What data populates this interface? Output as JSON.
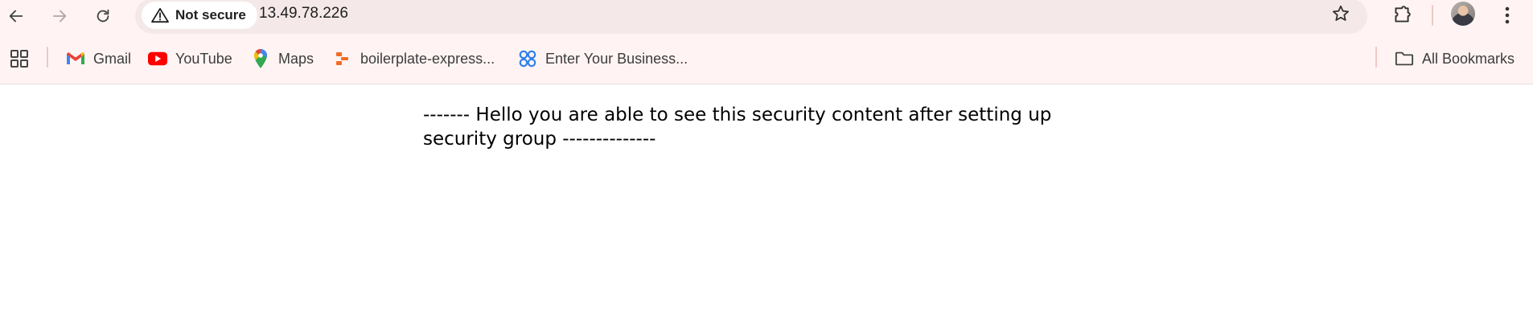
{
  "browser": {
    "security_label": "Not secure",
    "url": "13.49.78.226"
  },
  "bookmarks": [
    {
      "label": "Gmail",
      "icon": "gmail-icon"
    },
    {
      "label": "YouTube",
      "icon": "youtube-icon"
    },
    {
      "label": "Maps",
      "icon": "maps-icon"
    },
    {
      "label": "boilerplate-express...",
      "icon": "boilerplate-icon"
    },
    {
      "label": "Enter Your Business...",
      "icon": "business-icon"
    }
  ],
  "all_bookmarks_label": "All Bookmarks",
  "page": {
    "message": "------- Hello you are able to see this security content after setting up security group --------------"
  },
  "colors": {
    "chrome_bg": "#fff4f3",
    "omnibox_bg": "#f4e8e8",
    "youtube_red": "#ff0000",
    "gmail_red": "#ea4335"
  }
}
